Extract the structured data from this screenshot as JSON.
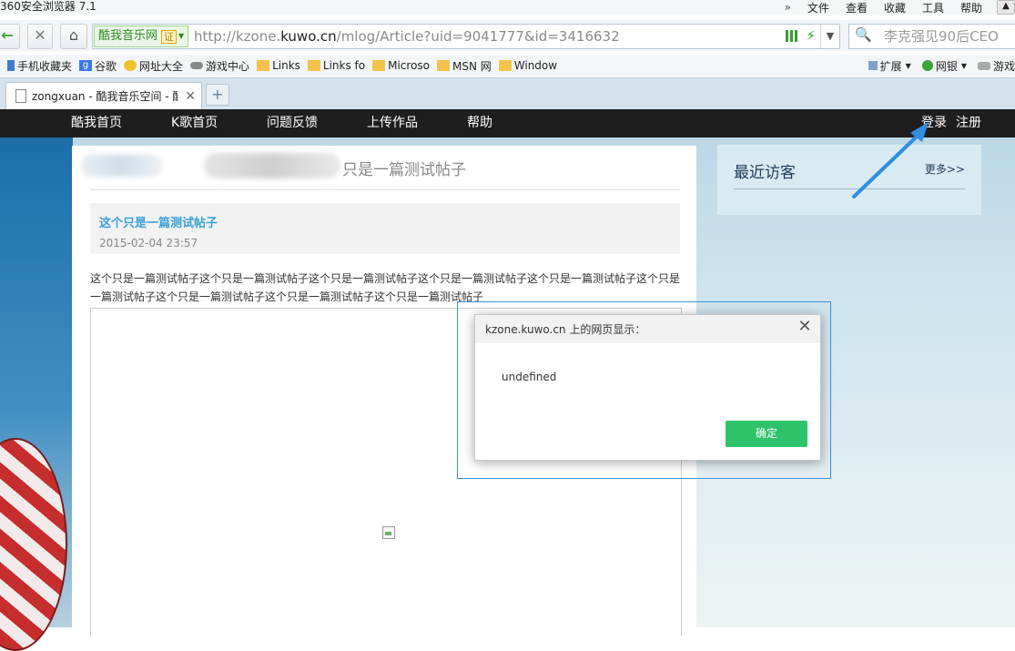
{
  "browser": {
    "app_title": "360安全浏览器 7.1",
    "menu": [
      "文件",
      "查看",
      "收藏",
      "工具",
      "帮助"
    ],
    "site_badge": "酷我音乐网",
    "cert_badge": "证",
    "url_prefix": "http://kzone.",
    "url_domain": "kuwo.cn",
    "url_suffix": "/mlog/Article?uid=9041777&id=3416632",
    "search_text": "李克强见90后CEO",
    "favorites": [
      {
        "label": "手机收藏夹",
        "icon": "phone-icon"
      },
      {
        "label": "谷歌",
        "icon": "google-icon"
      },
      {
        "label": "网址大全",
        "icon": "smiley-icon"
      },
      {
        "label": "游戏中心",
        "icon": "gamepad-icon"
      },
      {
        "label": "Links",
        "icon": "folder-icon"
      },
      {
        "label": "Links fo",
        "icon": "folder-icon"
      },
      {
        "label": "Microso",
        "icon": "folder-icon"
      },
      {
        "label": "MSN 网",
        "icon": "folder-icon"
      },
      {
        "label": "Window",
        "icon": "folder-icon"
      }
    ],
    "fav_right": [
      "扩展",
      "网银",
      "游戏"
    ],
    "tab_title": "zongxuan - 酷我音乐空间 - 酷我"
  },
  "site_nav": {
    "left": [
      "酷我首页",
      "K歌首页",
      "问题反馈",
      "上传作品",
      "帮助"
    ],
    "login": "登录",
    "register": "注册"
  },
  "article": {
    "heading_visible": "只是一篇测试帖子",
    "post_title": "这个只是一篇测试帖子",
    "post_date": "2015-02-04 23:57",
    "body": "这个只是一篇测试帖子这个只是一篇测试帖子这个只是一篇测试帖子这个只是一篇测试帖子这个只是一篇测试帖子这个只是一篇测试帖子这个只是一篇测试帖子这个只是一篇测试帖子这个只是一篇测试帖子"
  },
  "visitors": {
    "title": "最近访客",
    "more": "更多>>"
  },
  "dialog": {
    "title": "kzone.kuwo.cn 上的网页显示：",
    "message": "undefined",
    "ok": "确定"
  },
  "colors": {
    "accent_green": "#2ec36a",
    "link_blue": "#3aa0d8",
    "nav_dark": "#1e1e1e",
    "annotation_arrow": "#2f8ee0"
  }
}
